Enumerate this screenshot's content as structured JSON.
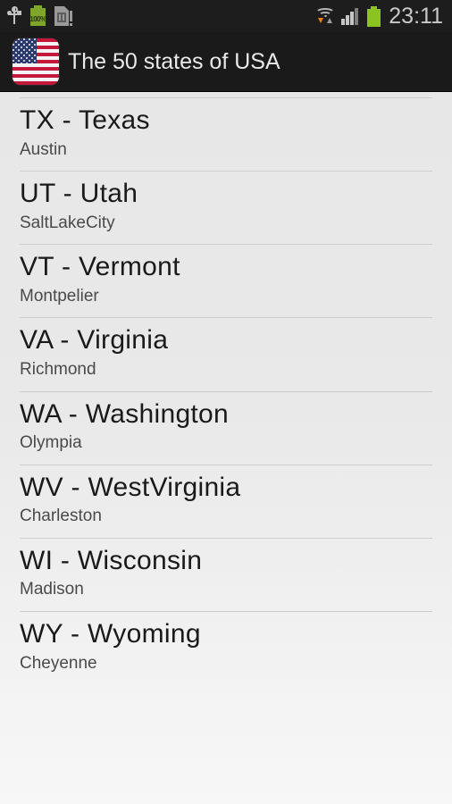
{
  "status_bar": {
    "time": "23:11",
    "battery_percent_label": "100%",
    "left_icons": [
      "usb-icon",
      "battery-percent-icon",
      "sd-card-warning-icon"
    ],
    "right_icons": [
      "wifi-icon",
      "cellular-signal-icon",
      "battery-icon"
    ],
    "colors": {
      "background": "#1d1d1d",
      "battery_green": "#8bc320",
      "accent_orange": "#e8820c"
    }
  },
  "action_bar": {
    "title": "The 50 states of USA",
    "app_icon": "usa-flag-icon",
    "colors": {
      "background": "#1a1a1a",
      "title": "#e9e9e9"
    }
  },
  "list": {
    "items": [
      {
        "title": "TX  -  Texas",
        "subtitle": "Austin"
      },
      {
        "title": "UT  -  Utah",
        "subtitle": "SaltLakeCity"
      },
      {
        "title": "VT  -  Vermont",
        "subtitle": "Montpelier"
      },
      {
        "title": "VA  -  Virginia",
        "subtitle": "Richmond"
      },
      {
        "title": "WA  -  Washington",
        "subtitle": "Olympia"
      },
      {
        "title": "WV  -  WestVirginia",
        "subtitle": "Charleston"
      },
      {
        "title": "WI  -  Wisconsin",
        "subtitle": "Madison"
      },
      {
        "title": "WY  -  Wyoming",
        "subtitle": "Cheyenne"
      }
    ],
    "colors": {
      "background_top": "#e7e7e7",
      "background_bottom": "#f7f7f7",
      "divider": "#cdcdcd",
      "title": "#1a1a1a",
      "subtitle": "#4a4a4a"
    }
  }
}
